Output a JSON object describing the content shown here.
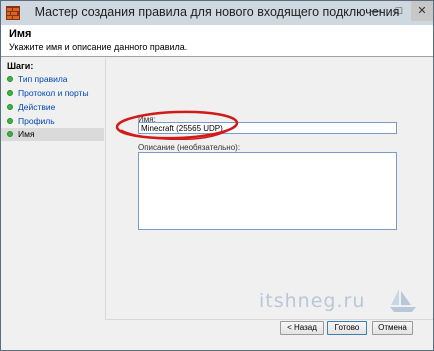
{
  "window": {
    "title": "Мастер создания правила для нового входящего подключения"
  },
  "header": {
    "title": "Имя",
    "subtitle": "Укажите имя и описание данного правила."
  },
  "steps": {
    "title": "Шаги:",
    "items": [
      {
        "label": "Тип правила"
      },
      {
        "label": "Протокол и порты"
      },
      {
        "label": "Действие"
      },
      {
        "label": "Профиль"
      },
      {
        "label": "Имя"
      }
    ]
  },
  "form": {
    "name_label": "Имя:",
    "name_value": "Minecraft (25565 UDP)",
    "desc_label": "Описание (необязательно):",
    "desc_value": ""
  },
  "buttons": {
    "back": "< Назад",
    "finish": "Готово",
    "cancel": "Отмена"
  },
  "watermark": {
    "text": "itshneg.ru"
  },
  "colors": {
    "accent": "#3c7fb1",
    "annotation": "#d11a1a",
    "step_done": "#3fb33f"
  }
}
